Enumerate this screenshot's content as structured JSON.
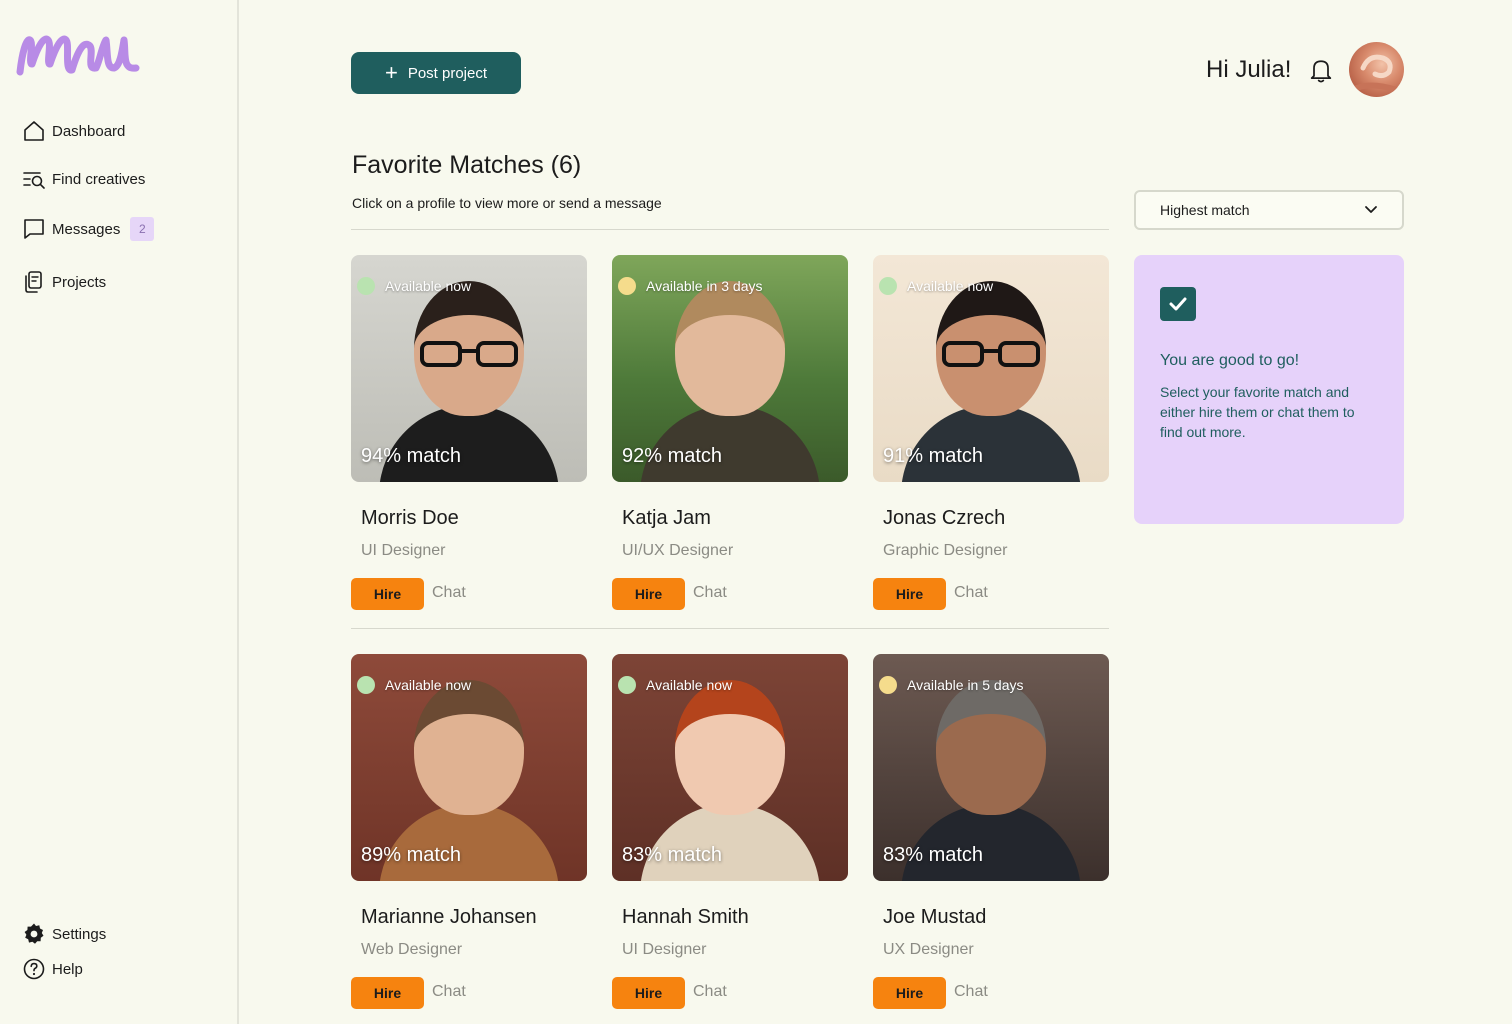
{
  "app": {
    "logo_text": "mu"
  },
  "sidebar": {
    "items": [
      {
        "label": "Dashboard",
        "icon": "home-icon"
      },
      {
        "label": "Find creatives",
        "icon": "search-list-icon"
      },
      {
        "label": "Messages",
        "icon": "message-icon",
        "badge": "2"
      },
      {
        "label": "Projects",
        "icon": "projects-icon"
      }
    ],
    "bottom": [
      {
        "label": "Settings",
        "icon": "gear-icon"
      },
      {
        "label": "Help",
        "icon": "help-icon"
      }
    ]
  },
  "header": {
    "post_button": "Post project",
    "greeting": "Hi Julia!"
  },
  "main": {
    "title": "Favorite Matches (6)",
    "subtitle": "Click on a profile to view more or send a message",
    "sort": {
      "selected": "Highest match"
    }
  },
  "info_card": {
    "title": "You are good to go!",
    "text": "Select your favorite match and either hire them or chat them to find out more."
  },
  "cards": [
    {
      "name": "Morris Doe",
      "role": "UI Designer",
      "availability": "Available now",
      "status": "now",
      "match": "94% match",
      "hire": "Hire",
      "chat": "Chat"
    },
    {
      "name": "Katja Jam",
      "role": "UI/UX Designer",
      "availability": "Available in 3 days",
      "status": "later",
      "match": "92% match",
      "hire": "Hire",
      "chat": "Chat"
    },
    {
      "name": "Jonas Czrech",
      "role": "Graphic Designer",
      "availability": "Available now",
      "status": "now",
      "match": "91% match",
      "hire": "Hire",
      "chat": "Chat"
    },
    {
      "name": "Marianne Johansen",
      "role": "Web Designer",
      "availability": "Available now",
      "status": "now",
      "match": "89% match",
      "hire": "Hire",
      "chat": "Chat"
    },
    {
      "name": "Hannah Smith",
      "role": "UI Designer",
      "availability": "Available now",
      "status": "now",
      "match": "83% match",
      "hire": "Hire",
      "chat": "Chat"
    },
    {
      "name": "Joe Mustad",
      "role": "UX Designer",
      "availability": "Available in 5 days",
      "status": "later",
      "match": "83% match",
      "hire": "Hire",
      "chat": "Chat"
    }
  ],
  "colors": {
    "brand": "#1f5e5e",
    "accent": "#f6830f",
    "logo": "#b88be6",
    "info_card_bg": "#e6d2fa",
    "available_now": "#b9e3b0",
    "available_later": "#f5dc8c"
  }
}
